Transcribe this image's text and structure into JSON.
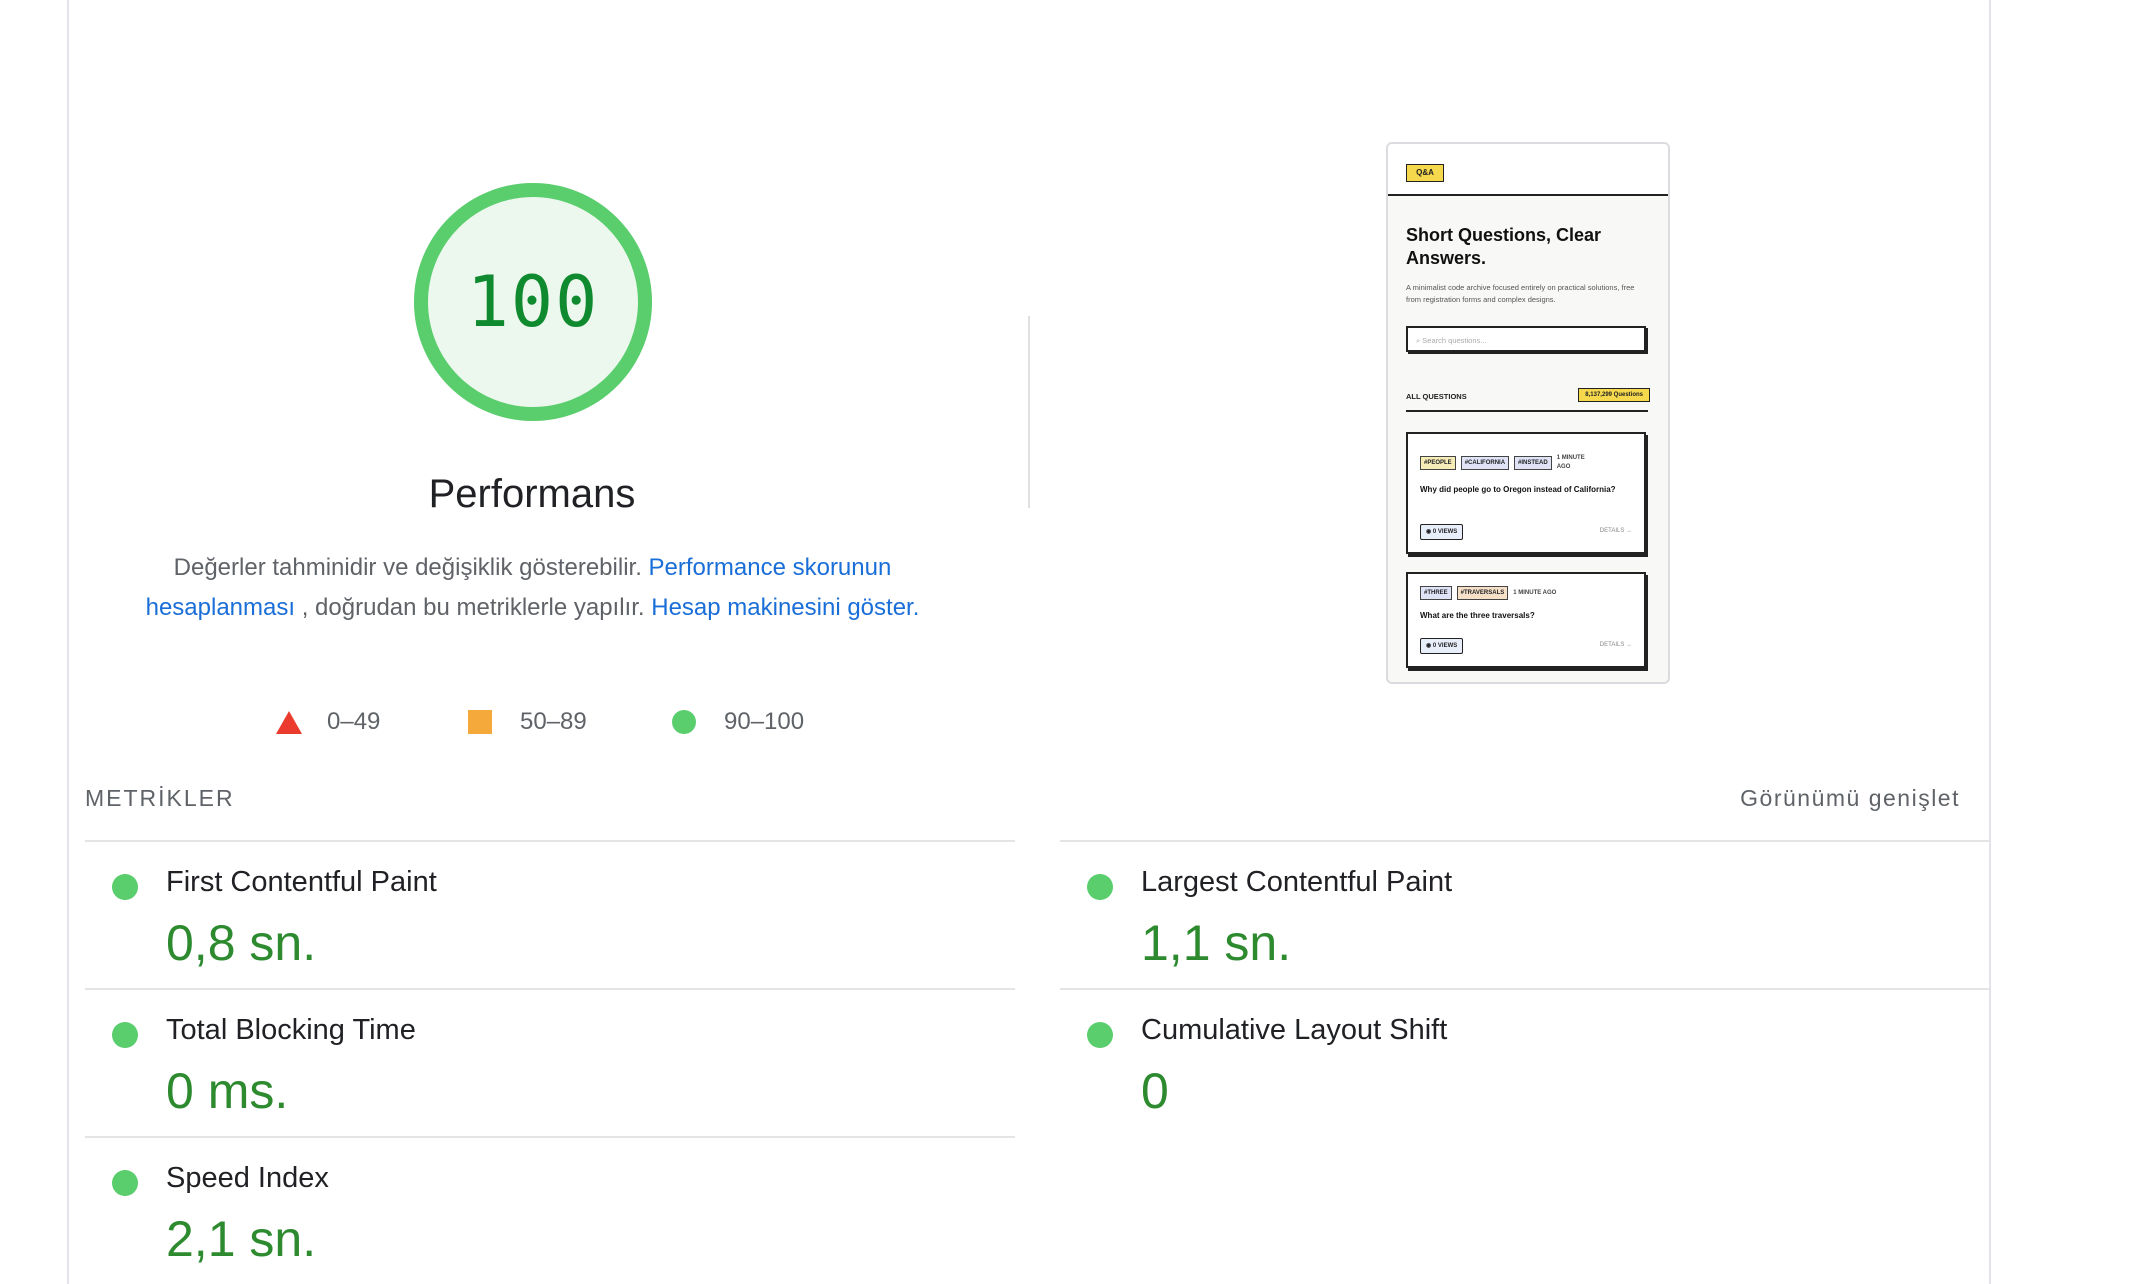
{
  "performance": {
    "score": "100",
    "title": "Performans",
    "description": {
      "text1": "Değerler tahminidir ve değişiklik gösterebilir.",
      "link1": "Performance skorunun hesaplanması",
      "text2": ", doğrudan bu metriklerle yapılır.",
      "link2": "Hesap makinesini göster."
    },
    "score_fraction": 1.0,
    "colors": {
      "pass": "#5acd6d",
      "pass_text": "#0f8a2e",
      "average": "#f4a93a",
      "fail": "#eb3b2f"
    }
  },
  "legend": [
    {
      "icon": "triangle-icon",
      "range": "0–49"
    },
    {
      "icon": "square-icon",
      "range": "50–89"
    },
    {
      "icon": "circle-icon",
      "range": "90–100"
    }
  ],
  "screenshot": {
    "logo": "Q&A",
    "title": "Short Questions, Clear Answers.",
    "subtitle": "A minimalist code archive focused entirely on practical solutions, free from registration forms and complex designs.",
    "search_placeholder": "Search questions...",
    "all_questions": "ALL QUESTIONS",
    "count": "8,137,299 Questions",
    "cards": [
      {
        "tags": [
          "#PEOPLE",
          "#CALIFORNIA",
          "#INSTEAD"
        ],
        "time": "1 MINUTE AGO",
        "question": "Why did people go to Oregon instead of California?",
        "views": "0 VIEWS",
        "details": "DETAILS →"
      },
      {
        "tags": [
          "#THREE",
          "#TRAVERSALS"
        ],
        "time": "1 MINUTE AGO",
        "question": "What are the three traversals?",
        "views": "0 VIEWS",
        "details": "DETAILS →"
      }
    ]
  },
  "metrics": {
    "header": "METRİKLER",
    "expand": "Görünümü genişlet",
    "items": [
      {
        "title": "First Contentful Paint",
        "value": "0,8 sn."
      },
      {
        "title": "Largest Contentful Paint",
        "value": "1,1 sn."
      },
      {
        "title": "Total Blocking Time",
        "value": "0 ms."
      },
      {
        "title": "Cumulative Layout Shift",
        "value": "0"
      },
      {
        "title": "Speed Index",
        "value": "2,1 sn."
      }
    ]
  }
}
